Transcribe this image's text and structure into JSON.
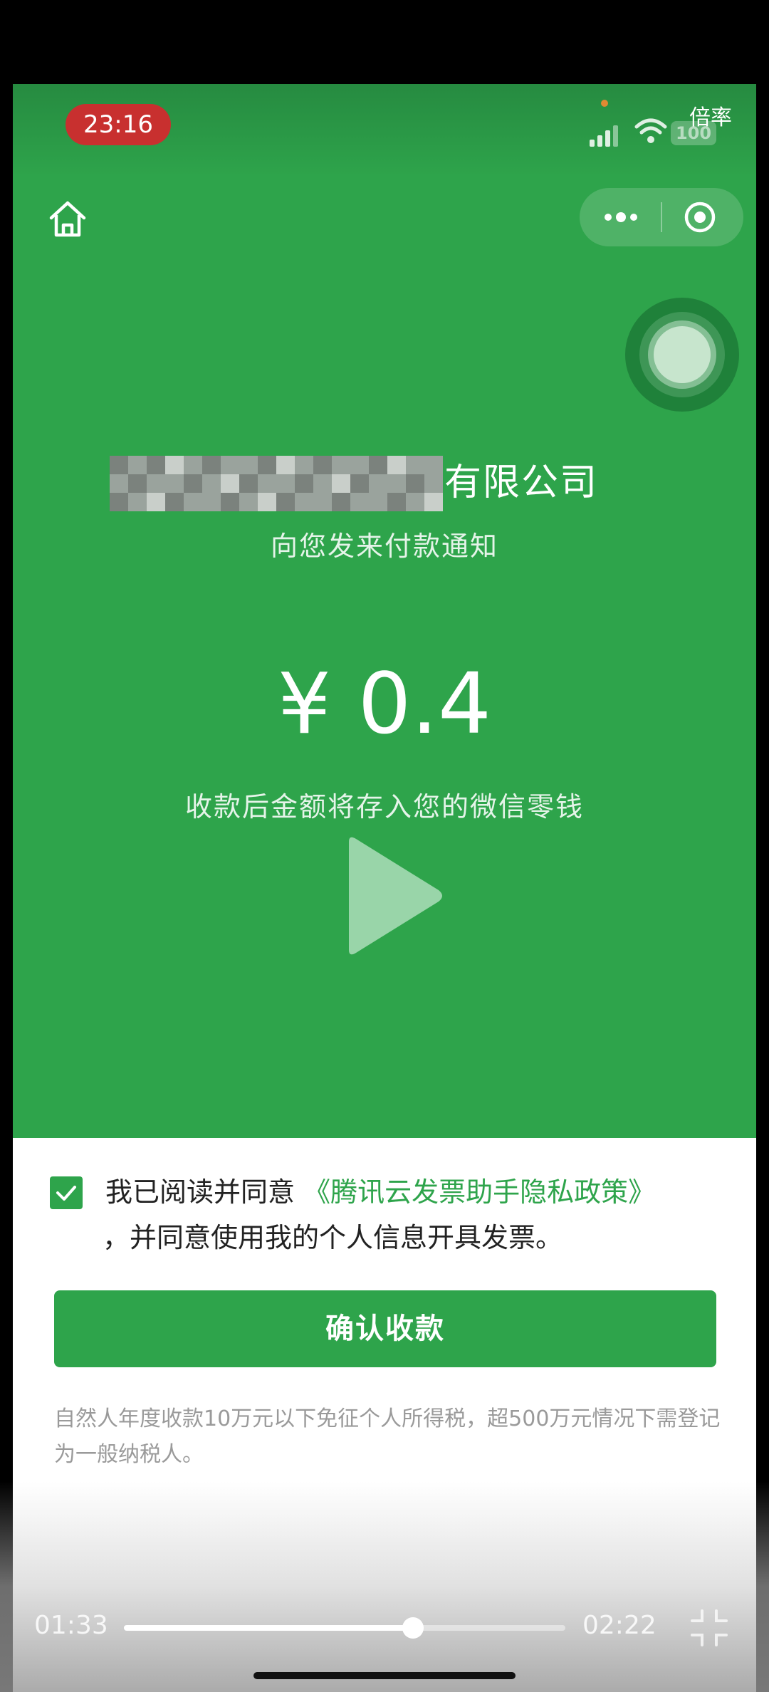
{
  "player": {
    "speed_label": "倍率",
    "current_time": "01:33",
    "total_time": "02:22",
    "progress": 0.655
  },
  "status_bar": {
    "time": "23:16",
    "battery": "100"
  },
  "icons": {
    "home": "home-icon",
    "more": "more-icon",
    "close": "close-target-icon",
    "play": "play-icon",
    "back": "chevron-left-icon",
    "fullscreen": "fullscreen-exit-icon"
  },
  "notice": {
    "company_suffix": "有限公司",
    "subtitle": "向您发来付款通知",
    "amount": "¥ 0.4",
    "deposit_note": "收款后金额将存入您的微信零钱"
  },
  "agreement": {
    "checked": true,
    "prefix": "我已阅读并同意 ",
    "policy_link": "《腾讯云发票助手隐私政策》",
    "line2": "，并同意使用我的个人信息开具发票。"
  },
  "confirm_button": "确认收款",
  "tax_note": "自然人年度收款10万元以下免征个人所得税，超500万元情况下需登记为一般纳税人。",
  "colors": {
    "brand_green": "#2ea44b",
    "time_pill_red": "#c8302f"
  }
}
